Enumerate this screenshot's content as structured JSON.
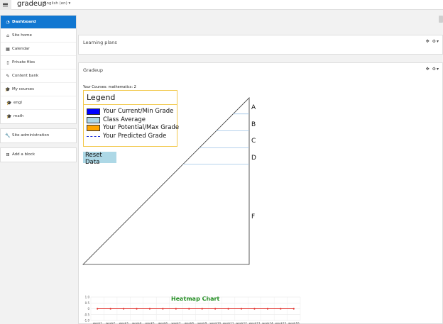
{
  "topbar": {
    "brand": "gradeup",
    "language": "English (en) ▾"
  },
  "sidebar": {
    "groups": [
      [
        {
          "label": "Dashboard",
          "icon": "dashboard-icon",
          "glyph": "◔",
          "active": true
        },
        {
          "label": "Site home",
          "icon": "home-icon",
          "glyph": "⌂"
        },
        {
          "label": "Calendar",
          "icon": "calendar-icon",
          "glyph": "▦"
        },
        {
          "label": "Private files",
          "icon": "file-icon",
          "glyph": "▯"
        },
        {
          "label": "Content bank",
          "icon": "brush-icon",
          "glyph": "✎"
        },
        {
          "label": "My courses",
          "icon": "graduation-cap-icon",
          "glyph": "🎓"
        },
        {
          "label": "engl",
          "icon": "graduation-cap-icon",
          "glyph": "🎓",
          "sub": true
        },
        {
          "label": "math",
          "icon": "graduation-cap-icon",
          "glyph": "🎓",
          "sub": true
        }
      ],
      [
        {
          "label": "Site administration",
          "icon": "wrench-icon",
          "glyph": "🔧"
        }
      ],
      [
        {
          "label": "Add a block",
          "icon": "plus-square-icon",
          "glyph": "⊞"
        }
      ]
    ]
  },
  "blocks": {
    "learning_plans": {
      "title": "Learning plans",
      "controls": "✥ ⚙▾"
    },
    "gradeup": {
      "title": "Gradeup",
      "controls": "✥ ⚙▾"
    }
  },
  "gradeup": {
    "courses_line": "Your Courses: mathematics: 2",
    "legend_title": "Legend",
    "legend": [
      {
        "label": "Your Current/Min Grade",
        "color": "#0000ff",
        "kind": "box"
      },
      {
        "label": "Class Average",
        "color": "#add8e6",
        "kind": "box"
      },
      {
        "label": "Your Potential/Max Grade",
        "color": "#ffa500",
        "kind": "box"
      },
      {
        "label": "Your Predicted Grade",
        "color": "#1a2fd6",
        "kind": "dash"
      }
    ],
    "reset_label": "Reset Data",
    "grade_letters": [
      "A",
      "B",
      "C",
      "D",
      "F"
    ]
  },
  "chart_data": {
    "type": "line",
    "title": "Heatmap Chart",
    "categories": [
      "week1",
      "week2",
      "week3",
      "week4",
      "week5",
      "week6",
      "week7",
      "week8",
      "week9",
      "week10",
      "week11",
      "week12",
      "week13",
      "week14",
      "week15",
      "week16"
    ],
    "series": [
      {
        "values": [
          0,
          0,
          0,
          0,
          0,
          0,
          0,
          0,
          0,
          0,
          0,
          0,
          0,
          0,
          0,
          0
        ],
        "color": "#e0201b"
      }
    ],
    "ylim": [
      -1.0,
      1.0
    ],
    "yticks": [
      "1.0",
      "0.5",
      "0",
      "-0.5",
      "-1.0"
    ],
    "grid": true
  }
}
